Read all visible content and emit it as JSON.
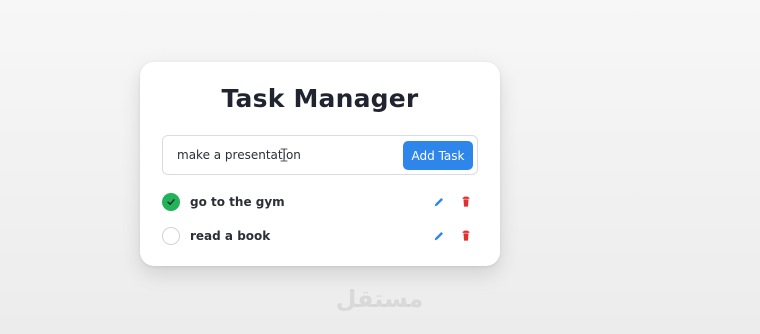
{
  "app": {
    "title": "Task Manager"
  },
  "composer": {
    "input_value": "make a presentation",
    "add_button_label": "Add Task"
  },
  "tasks": [
    {
      "label": "go to the gym",
      "completed": true
    },
    {
      "label": "read a book",
      "completed": false
    }
  ],
  "colors": {
    "accent": "#2f86ea",
    "success": "#22b35a",
    "danger": "#e03131",
    "edit": "#2f86ea"
  },
  "icons": {
    "edit": "pencil-icon",
    "delete": "trash-icon",
    "completed": "check-icon",
    "cursor": "text-cursor-icon"
  },
  "branding": {
    "watermark": "مستقل"
  }
}
